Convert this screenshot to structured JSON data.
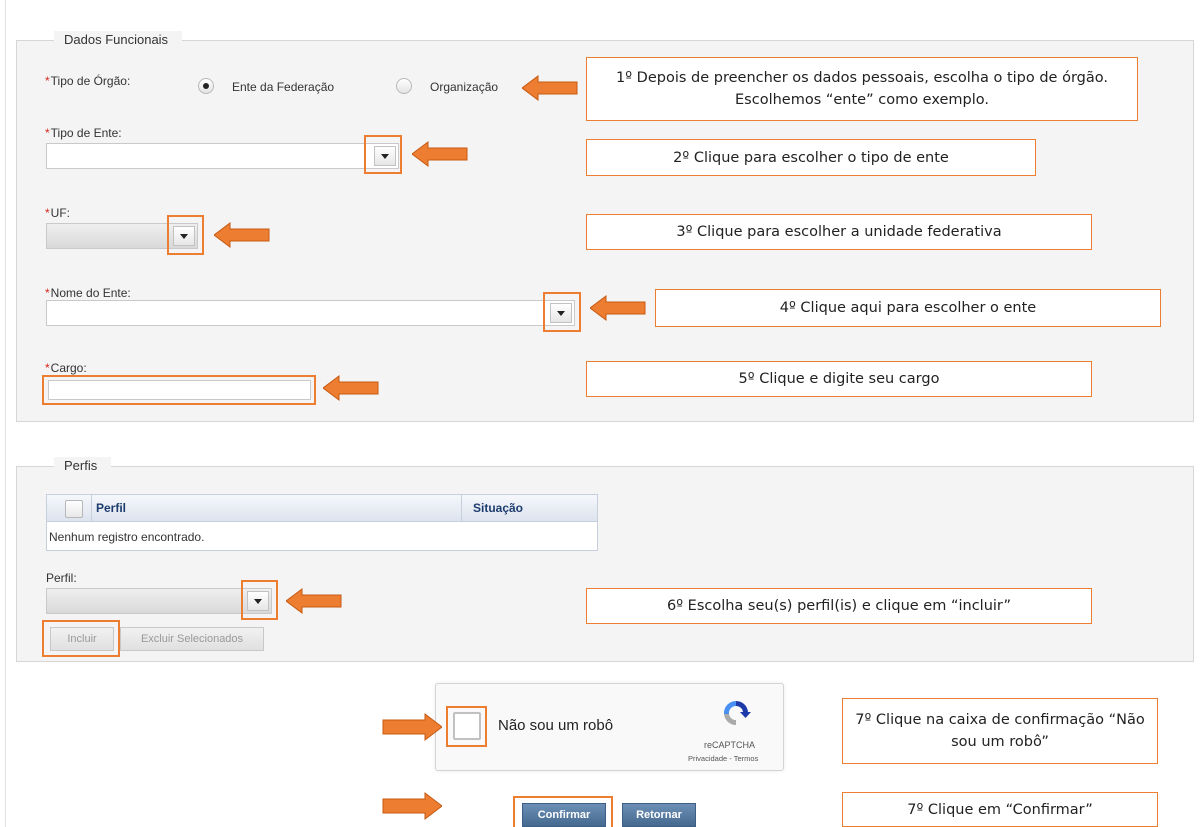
{
  "dados_funcionais": {
    "legend": "Dados Funcionais",
    "tipo_orgao": {
      "required": "*",
      "label": "Tipo de Órgão:",
      "options": [
        "Ente da Federação",
        "Organização"
      ],
      "selected": "Ente da Federação"
    },
    "tipo_ente": {
      "required": "*",
      "label": "Tipo de Ente:",
      "value": ""
    },
    "uf": {
      "required": "*",
      "label": "UF:",
      "value": ""
    },
    "nome_ente": {
      "required": "*",
      "label": "Nome do Ente:",
      "value": ""
    },
    "cargo": {
      "required": "*",
      "label": "Cargo:",
      "value": ""
    }
  },
  "perfis": {
    "legend": "Perfis",
    "columns": [
      "Perfil",
      "Situação"
    ],
    "empty_message": "Nenhum registro encontrado.",
    "perfil_label": "Perfil:",
    "incluir_label": "Incluir",
    "excluir_label": "Excluir Selecionados"
  },
  "recaptcha": {
    "label": "Não sou um robô",
    "brand": "reCAPTCHA",
    "links": "Privacidade - Termos"
  },
  "actions": {
    "confirmar": "Confirmar",
    "retornar": "Retornar"
  },
  "callouts": {
    "step1": "1º Depois de preencher os dados pessoais, escolha o tipo de órgão. Escolhemos “ente” como exemplo.",
    "step2": "2º Clique para escolher o tipo de ente",
    "step3": "3º Clique para escolher a unidade federativa",
    "step4": "4º Clique aqui para escolher o ente",
    "step5": "5º Clique e digite seu cargo",
    "step6": "6º Escolha seu(s) perfil(is) e clique em “incluir”",
    "step7a": "7º Clique na caixa de confirmação “Não sou um robô”",
    "step7b": "7º Clique em “Confirmar”"
  },
  "colors": {
    "highlight": "#ed7d31",
    "required": "#d9251c",
    "header_text": "#1d3c6e",
    "primary_button": "#44698f"
  }
}
